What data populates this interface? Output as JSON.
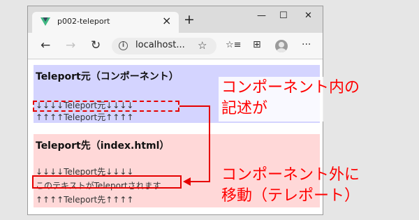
{
  "browser": {
    "tab_title": "p002-teleport",
    "url": "localhost...",
    "buttons": {
      "back": "←",
      "forward": "→",
      "reload": "↻",
      "star": "☆",
      "favorites": "☆≡",
      "collections": "⊞",
      "more": "···",
      "new_tab": "+",
      "tab_close": "×",
      "minimize": "—",
      "maximize": "☐",
      "close": "✕"
    },
    "colors": {
      "vue_logo": "#41b883",
      "vue_logo_dark": "#35495e"
    }
  },
  "page": {
    "component_section": {
      "heading": "Teleport元（コンポーネント）",
      "line1": "↓↓↓↓Teleport元↓↓↓↓",
      "line2": "↑↑↑↑Teleport元↑↑↑↑"
    },
    "index_section": {
      "heading": "Teleport先（index.html）",
      "line1": "↓↓↓↓Teleport先↓↓↓↓",
      "teleported_text": "このテキストがTeleportされます",
      "line2": "↑↑↑↑Teleport先↑↑↑↑"
    },
    "colors": {
      "component_bg": "#d4d4ff",
      "index_bg": "#ffd8d8"
    }
  },
  "annotations": {
    "top_line1": "コンポーネント内の",
    "top_line2": "記述が",
    "bottom_line1": "コンポーネント外に",
    "bottom_line2": "移動（テレポート）",
    "color": "#ff0000"
  }
}
